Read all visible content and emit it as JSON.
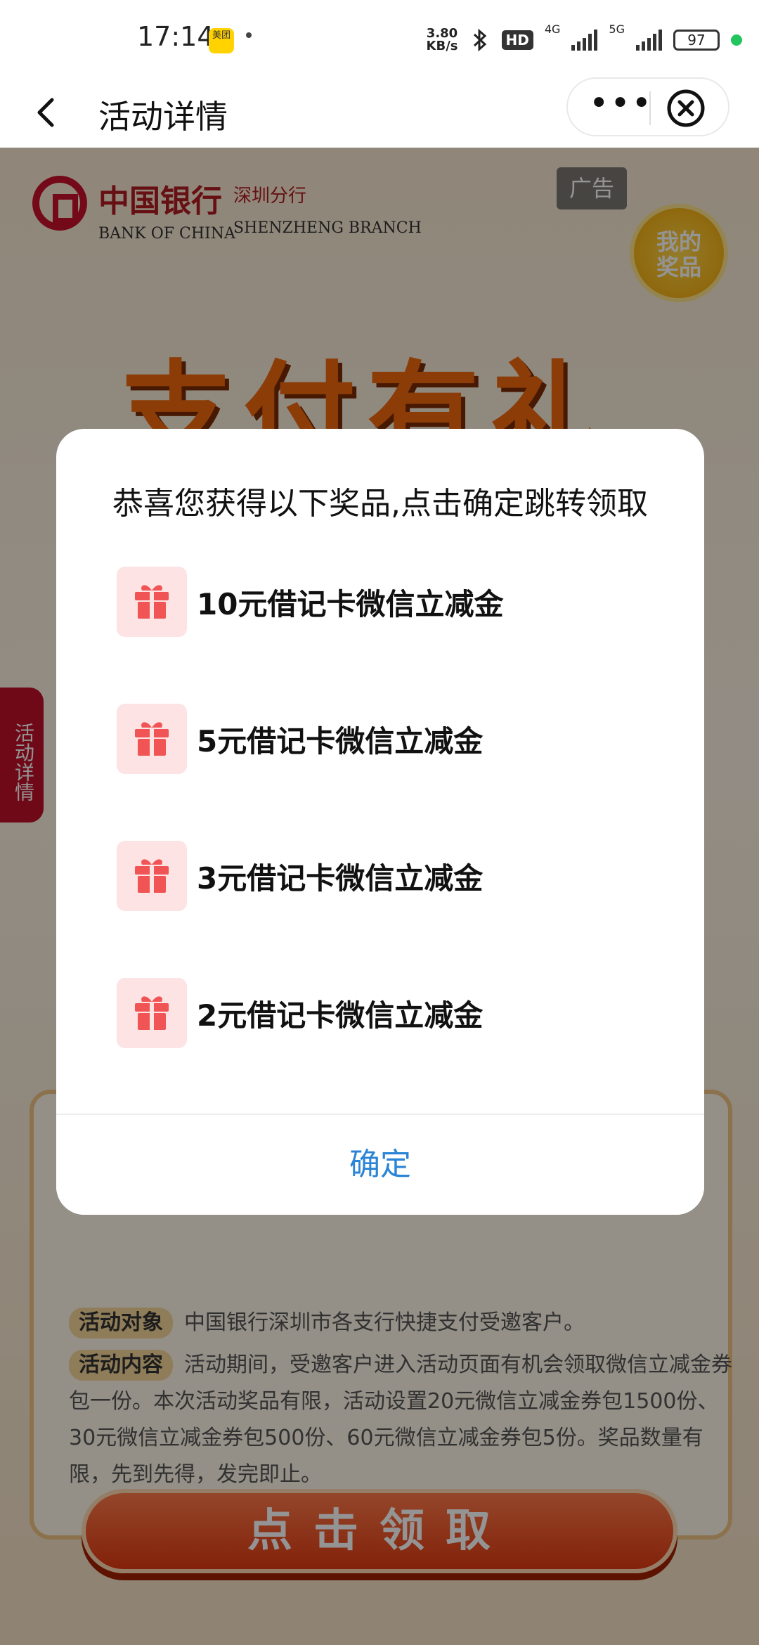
{
  "status_bar": {
    "time": "17:14",
    "app_icon": "美团",
    "net_speed_value": "3.80",
    "net_speed_unit": "KB/s",
    "hd": "HD",
    "network_1": "4G",
    "network_2": "5G",
    "battery": "97"
  },
  "title_bar": {
    "title": "活动详情",
    "more": "•••"
  },
  "background_page": {
    "logo_cn": "中国银行",
    "branch_cn": "深圳分行",
    "logo_en": "BANK OF CHINA",
    "branch_en": "SHENZHENG BRANCH",
    "ad_label": "广告",
    "my_prize_line1": "我的",
    "my_prize_line2": "奖品",
    "hero_title": "支付有礼",
    "side_tab": "活动详情",
    "target_tag": "活动对象",
    "target_text": "中国银行深圳市各支行快捷支付受邀客户。",
    "content_tag": "活动内容",
    "content_text": "活动期间，受邀客户进入活动页面有机会领取微信立减金券包一份。本次活动奖品有限，活动设置20元微信立减金券包1500份、30元微信立减金券包500份、60元微信立减金券包5份。奖品数量有限，先到先得，发完即止。",
    "claim_button": "点击领取"
  },
  "modal": {
    "title": "恭喜您获得以下奖品,点击确定跳转领取",
    "prizes": [
      {
        "label": "10元借记卡微信立减金"
      },
      {
        "label": "5元借记卡微信立减金"
      },
      {
        "label": "3元借记卡微信立减金"
      },
      {
        "label": "2元借记卡微信立减金"
      }
    ],
    "confirm": "确定"
  },
  "colors": {
    "confirm_blue": "#2b84d6",
    "gift_red": "#f05454",
    "gift_bg": "#fde3e3",
    "bank_red": "#c8102e"
  }
}
